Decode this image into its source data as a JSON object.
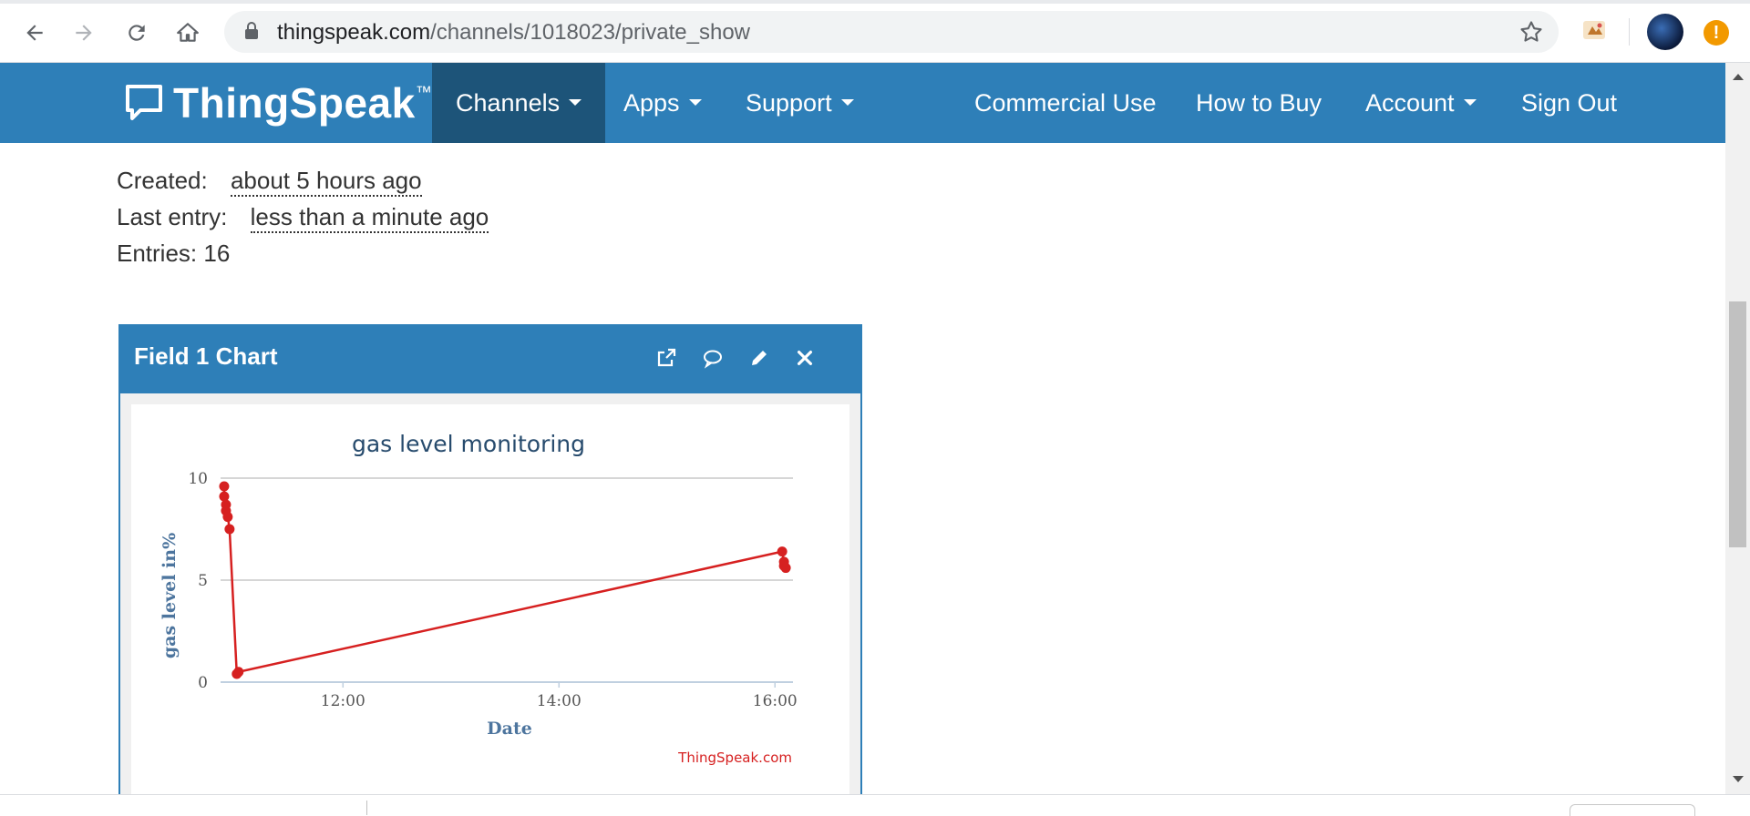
{
  "browser": {
    "url_host": "thingspeak.com",
    "url_path": "/channels/1018023/private_show"
  },
  "nav": {
    "logo_text": "ThingSpeak",
    "logo_tm": "™",
    "items": [
      {
        "label": "Channels",
        "dropdown": true,
        "active": true
      },
      {
        "label": "Apps",
        "dropdown": true
      },
      {
        "label": "Support",
        "dropdown": true
      },
      {
        "label": "Commercial Use",
        "dropdown": false
      },
      {
        "label": "How to Buy",
        "dropdown": false
      },
      {
        "label": "Account",
        "dropdown": true
      },
      {
        "label": "Sign Out",
        "dropdown": false
      }
    ],
    "colors": {
      "bar": "#2e7fb8",
      "active": "#1d5479"
    }
  },
  "channel": {
    "created_label": "Created:",
    "created_value": "about 5 hours ago",
    "last_entry_label": "Last entry:",
    "last_entry_value": "less than a minute ago",
    "entries_text": "Entries: 16"
  },
  "widget": {
    "title": "Field 1 Chart",
    "icons": [
      "external-link-icon",
      "comment-icon",
      "pencil-icon",
      "close-icon"
    ]
  },
  "chart_data": {
    "type": "line",
    "title": "gas level monitoring",
    "xlabel": "Date",
    "ylabel": "gas level in%",
    "credit": "ThingSpeak.com",
    "x_ticks": [
      "12:00",
      "14:00",
      "16:00"
    ],
    "y_ticks": [
      "0",
      "5",
      "10"
    ],
    "ylim": [
      0,
      10
    ],
    "xlim": [
      "10:52",
      "16:10"
    ],
    "series": [
      {
        "color": "#d62020",
        "points": [
          {
            "x": "10:54",
            "y": 9.6
          },
          {
            "x": "10:54",
            "y": 9.1
          },
          {
            "x": "10:55",
            "y": 8.7
          },
          {
            "x": "10:55",
            "y": 8.4
          },
          {
            "x": "10:56",
            "y": 8.1
          },
          {
            "x": "10:57",
            "y": 7.5
          },
          {
            "x": "11:01",
            "y": 0.4
          },
          {
            "x": "11:02",
            "y": 0.5
          },
          {
            "x": "16:04",
            "y": 6.4
          },
          {
            "x": "16:05",
            "y": 5.9
          },
          {
            "x": "16:05",
            "y": 5.7
          },
          {
            "x": "16:06",
            "y": 5.6
          }
        ]
      }
    ]
  }
}
